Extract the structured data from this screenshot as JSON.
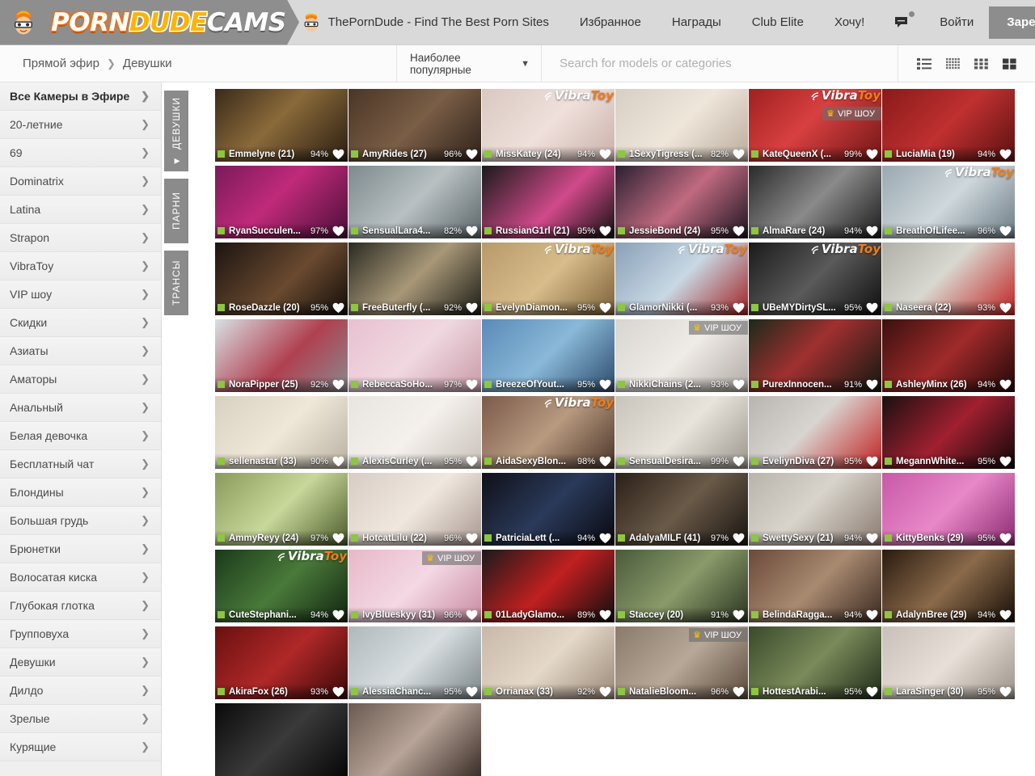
{
  "header": {
    "logo": {
      "part1": "PORN",
      "part2": "DUDE",
      "part3": "CAMS",
      "mascot_icon": "dude-mascot-icon"
    },
    "nav": [
      {
        "label": "ThePornDude - Find The Best Porn Sites",
        "name": "nav-theporndude"
      },
      {
        "label": "Избранное",
        "name": "nav-favorites"
      },
      {
        "label": "Награды",
        "name": "nav-awards"
      },
      {
        "label": "Club Elite",
        "name": "nav-club-elite"
      },
      {
        "label": "Хочу!",
        "name": "nav-want"
      }
    ],
    "chat_icon": "chat-bubble-icon",
    "login_label": "Войти",
    "register_label": "Зарегистрироват"
  },
  "subbar": {
    "breadcrumb": {
      "root": "Прямой эфир",
      "separator": "❯",
      "current": "Девушки"
    },
    "sort": {
      "value": "Наиболее популярные",
      "caret": "▼"
    },
    "search": {
      "placeholder": "Search for models or categories",
      "value": ""
    },
    "view_modes": [
      {
        "name": "view-mode-list",
        "icon": "list-view-icon",
        "active": false
      },
      {
        "name": "view-mode-tiny",
        "icon": "tiny-grid-icon",
        "active": false
      },
      {
        "name": "view-mode-small",
        "icon": "small-grid-icon",
        "active": false
      },
      {
        "name": "view-mode-large",
        "icon": "large-grid-icon",
        "active": true
      }
    ]
  },
  "sidebar": {
    "items": [
      {
        "label": "Все Камеры в Эфире",
        "active": true
      },
      {
        "label": "20-летние",
        "active": false
      },
      {
        "label": "69",
        "active": false
      },
      {
        "label": "Dominatrix",
        "active": false
      },
      {
        "label": "Latina",
        "active": false
      },
      {
        "label": "Strapon",
        "active": false
      },
      {
        "label": "VibraToy",
        "active": false
      },
      {
        "label": "VIP шоу",
        "active": false
      },
      {
        "label": " Скидки",
        "active": false
      },
      {
        "label": "Азиаты",
        "active": false
      },
      {
        "label": "Аматоры",
        "active": false
      },
      {
        "label": "Анальный",
        "active": false
      },
      {
        "label": "Белая девочка",
        "active": false
      },
      {
        "label": "Бесплатный чат",
        "active": false
      },
      {
        "label": "Блондины",
        "active": false
      },
      {
        "label": "Большая грудь",
        "active": false
      },
      {
        "label": "Брюнетки",
        "active": false
      },
      {
        "label": "Волосатая киска",
        "active": false
      },
      {
        "label": "Глубокая глотка",
        "active": false
      },
      {
        "label": "Групповуха",
        "active": false
      },
      {
        "label": "Девушки",
        "active": false
      },
      {
        "label": "Дилдо",
        "active": false
      },
      {
        "label": "Зрелые",
        "active": false
      },
      {
        "label": "Курящие",
        "active": false
      }
    ]
  },
  "vertical_tabs": [
    {
      "label": "ДЕВУШКИ",
      "active": true,
      "arrow": "◀"
    },
    {
      "label": "ПАРНИ",
      "active": false,
      "arrow": ""
    },
    {
      "label": "ТРАНСЫ",
      "active": false,
      "arrow": ""
    }
  ],
  "badges": {
    "vibratoy": {
      "part1": "Vibra",
      "part2": "Toy"
    },
    "vip": "VIP ШОУ"
  },
  "colors": {
    "live_dot": "#8dc63f",
    "vibratoy_orange": "#f07c1b",
    "crown_gold": "#ffc400",
    "register_bg": "#8d8d8d",
    "header_bg": "#d9d9d9"
  },
  "cards": [
    {
      "name": "Emmelyne (21)",
      "pct": "94%",
      "vibra": false,
      "vip": false,
      "bg": "linear-gradient(135deg,#3a2a1a,#8a6a3a 45%,#2a1d12)"
    },
    {
      "name": "AmyRides (27)",
      "pct": "96%",
      "vibra": false,
      "vip": false,
      "bg": "linear-gradient(135deg,#4a3526,#7a5e46 50%,#2e211a)"
    },
    {
      "name": "MissKatey (24)",
      "pct": "94%",
      "vibra": true,
      "vip": false,
      "bg": "linear-gradient(135deg,#d8c8c0,#f0e0dc 50%,#c8b0a8)"
    },
    {
      "name": "1SexyTigress (...",
      "pct": "82%",
      "vibra": false,
      "vip": false,
      "bg": "linear-gradient(135deg,#d8cfc4,#efe6da 50%,#b8ab9c)"
    },
    {
      "name": "KateQueenX (...",
      "pct": "99%",
      "vibra": true,
      "vip": true,
      "bg": "linear-gradient(135deg,#a02020,#d84040 45%,#701515)"
    },
    {
      "name": "LuciaMia (19)",
      "pct": "94%",
      "vibra": false,
      "vip": false,
      "bg": "linear-gradient(135deg,#8a1a1a,#c03030 50%,#5a1010)"
    },
    {
      "name": "RyanSucculen...",
      "pct": "97%",
      "vibra": false,
      "vip": false,
      "bg": "linear-gradient(135deg,#7a1a5a,#c02a7a 45%,#4a0f38)"
    },
    {
      "name": "SensualLara4...",
      "pct": "82%",
      "vibra": false,
      "vip": false,
      "bg": "linear-gradient(135deg,#7e8a8e,#b8c0c2 50%,#5a6468)"
    },
    {
      "name": "RussianG1rl (21)",
      "pct": "95%",
      "vibra": false,
      "vip": false,
      "bg": "linear-gradient(135deg,#1a1a1a,#d04a8a 55%,#101010)"
    },
    {
      "name": "JessieBond (24)",
      "pct": "95%",
      "vibra": false,
      "vip": false,
      "bg": "linear-gradient(135deg,#2a2030,#c06a80 50%,#1a1420)"
    },
    {
      "name": "AlmaRare (24)",
      "pct": "94%",
      "vibra": false,
      "vip": false,
      "bg": "linear-gradient(135deg,#2a2a2a,#8a8a8a 50%,#1a1a1a)"
    },
    {
      "name": "BreathOfLifee...",
      "pct": "96%",
      "vibra": true,
      "vip": false,
      "bg": "linear-gradient(135deg,#9aa8b0,#cfd8dc 50%,#6a7a84)"
    },
    {
      "name": "RoseDazzle (20)",
      "pct": "95%",
      "vibra": false,
      "vip": false,
      "bg": "linear-gradient(135deg,#1c1410,#6a4a30 55%,#120c08)"
    },
    {
      "name": "FreeButerfly (...",
      "pct": "92%",
      "vibra": false,
      "vip": false,
      "bg": "linear-gradient(135deg,#2a2a22,#a89878 50%,#1a1a14)"
    },
    {
      "name": "EvelynDiamon...",
      "pct": "95%",
      "vibra": true,
      "vip": false,
      "bg": "linear-gradient(135deg,#b89a6a,#d8bc8a 50%,#7a6038)"
    },
    {
      "name": "GlamorNikki (...",
      "pct": "93%",
      "vibra": true,
      "vip": false,
      "bg": "linear-gradient(135deg,#8aa0b8,#c8d8e4 50%,#a02020)"
    },
    {
      "name": "UBeMYDirtySL...",
      "pct": "95%",
      "vibra": true,
      "vip": false,
      "bg": "linear-gradient(135deg,#1a1a1a,#5a5a5a 50%,#0e0e0e)"
    },
    {
      "name": "Naseera (22)",
      "pct": "93%",
      "vibra": false,
      "vip": false,
      "bg": "linear-gradient(135deg,#b0b0a8,#d8d8d0 45%,#c02020)"
    },
    {
      "name": "NoraPipper (25)",
      "pct": "92%",
      "vibra": false,
      "vip": false,
      "bg": "linear-gradient(135deg,#d8e0e4,#b04050 55%,#8a8a90)"
    },
    {
      "name": "RebeccaSoHo...",
      "pct": "97%",
      "vibra": false,
      "vip": false,
      "bg": "linear-gradient(135deg,#e8c0d0,#f0d8e0 50%,#c89aa8)"
    },
    {
      "name": "BreezeOfYout...",
      "pct": "95%",
      "vibra": false,
      "vip": false,
      "bg": "linear-gradient(135deg,#5a8ab8,#8ab8d8 50%,#2a4a6a)"
    },
    {
      "name": "NikkiChains (2...",
      "pct": "93%",
      "vibra": false,
      "vip": true,
      "bg": "linear-gradient(135deg,#d8d4d0,#efebe6 50%,#b0aaa4)"
    },
    {
      "name": "PurexInnocen...",
      "pct": "91%",
      "vibra": false,
      "vip": false,
      "bg": "linear-gradient(135deg,#1a2a1a,#a03030 45%,#101810)"
    },
    {
      "name": "AshleyMinx (26)",
      "pct": "94%",
      "vibra": false,
      "vip": false,
      "bg": "linear-gradient(135deg,#3a1010,#a02a2a 50%,#200808)"
    },
    {
      "name": "sellenastar (33)",
      "pct": "90%",
      "vibra": false,
      "vip": false,
      "bg": "linear-gradient(135deg,#d8d0c0,#efe8d8 50%,#b8b0a0)"
    },
    {
      "name": "AlexisCurley (...",
      "pct": "95%",
      "vibra": false,
      "vip": false,
      "bg": "linear-gradient(135deg,#e8e4e0,#f4f0ec 50%,#c8c0b8)"
    },
    {
      "name": "AidaSexyBlon...",
      "pct": "98%",
      "vibra": true,
      "vip": false,
      "bg": "linear-gradient(135deg,#7a5a4a,#b89a80 50%,#4a3428)"
    },
    {
      "name": "SensualDesira...",
      "pct": "99%",
      "vibra": false,
      "vip": false,
      "bg": "linear-gradient(135deg,#c8c4bc,#e8e4dc 50%,#9a948c)"
    },
    {
      "name": "EveliynDiva (27)",
      "pct": "95%",
      "vibra": false,
      "vip": false,
      "bg": "linear-gradient(135deg,#b8b4b0,#d8d4d0 45%,#c02020)"
    },
    {
      "name": "MegannWhite...",
      "pct": "95%",
      "vibra": false,
      "vip": false,
      "bg": "linear-gradient(135deg,#1a1010,#a02030 50%,#0e0808)"
    },
    {
      "name": "AmmyReyy (24)",
      "pct": "97%",
      "vibra": false,
      "vip": false,
      "bg": "linear-gradient(135deg,#8a9a5a,#c8d89a 50%,#4a5a2a)"
    },
    {
      "name": "HotcatLilu (22)",
      "pct": "96%",
      "vibra": false,
      "vip": false,
      "bg": "linear-gradient(135deg,#d8ccc4,#f0e8e0 50%,#a89890)"
    },
    {
      "name": "PatriciaLett (...",
      "pct": "94%",
      "vibra": false,
      "vip": false,
      "bg": "linear-gradient(135deg,#101018,#2a3a5a 50%,#08080e)"
    },
    {
      "name": "AdalyaMILF (41)",
      "pct": "97%",
      "vibra": false,
      "vip": false,
      "bg": "linear-gradient(135deg,#2a2018,#6a5a48 50%,#181410)"
    },
    {
      "name": "SwettySexy (21)",
      "pct": "94%",
      "vibra": false,
      "vip": false,
      "bg": "linear-gradient(135deg,#b8b4ac,#d8d4cc 45%,#8a7a70)"
    },
    {
      "name": "KittyBenks (29)",
      "pct": "95%",
      "vibra": false,
      "vip": false,
      "bg": "linear-gradient(135deg,#c858a8,#e888c8 50%,#8a2a70)"
    },
    {
      "name": "CuteStephani...",
      "pct": "94%",
      "vibra": true,
      "vip": false,
      "bg": "linear-gradient(135deg,#1a3a1a,#4a7a3a 50%,#102410)"
    },
    {
      "name": "IvyBlueskyy (31)",
      "pct": "96%",
      "vibra": false,
      "vip": true,
      "bg": "linear-gradient(135deg,#e8b8c8,#f4d8e4 50%,#c88aa0)"
    },
    {
      "name": "01LadyGlamo...",
      "pct": "89%",
      "vibra": false,
      "vip": false,
      "bg": "linear-gradient(135deg,#1a1a1a,#c02020 50%,#0e0e0e)"
    },
    {
      "name": "Staccey (20)",
      "pct": "91%",
      "vibra": false,
      "vip": false,
      "bg": "linear-gradient(135deg,#4a5a3a,#8a9a6a 50%,#2a3420)"
    },
    {
      "name": "BelindaRagga...",
      "pct": "94%",
      "vibra": false,
      "vip": false,
      "bg": "linear-gradient(135deg,#6a4a3a,#a88a70 50%,#3a2820)"
    },
    {
      "name": "AdalynBree (29)",
      "pct": "94%",
      "vibra": false,
      "vip": false,
      "bg": "linear-gradient(135deg,#2a1a10,#8a6a4a 50%,#180e08)"
    },
    {
      "name": "AkiraFox (26)",
      "pct": "93%",
      "vibra": false,
      "vip": false,
      "bg": "linear-gradient(135deg,#6a1010,#b02828 50%,#3a0808)"
    },
    {
      "name": "AlessiaChanc...",
      "pct": "95%",
      "vibra": false,
      "vip": false,
      "bg": "linear-gradient(135deg,#b0b8bc,#d8dee0 50%,#7a8488)"
    },
    {
      "name": "Orrianax (33)",
      "pct": "92%",
      "vibra": false,
      "vip": false,
      "bg": "linear-gradient(135deg,#c8b8a8,#e4d8c8 50%,#9a8878)"
    },
    {
      "name": "NatalieBloom...",
      "pct": "96%",
      "vibra": false,
      "vip": true,
      "bg": "linear-gradient(135deg,#8a7a6a,#b8a898 50%,#5a4a3a)"
    },
    {
      "name": "HottestArabi...",
      "pct": "95%",
      "vibra": false,
      "vip": false,
      "bg": "linear-gradient(135deg,#3a4a2a,#7a8a5a 50%,#202a18)"
    },
    {
      "name": "LaraSinger (30)",
      "pct": "95%",
      "vibra": false,
      "vip": false,
      "bg": "linear-gradient(135deg,#c8c0b8,#e8e0d8 50%,#9a9088)"
    },
    {
      "name": "",
      "pct": "",
      "vibra": false,
      "vip": false,
      "bg": "linear-gradient(135deg,#0a0a0a,#3a3a3a 50%,#060606)"
    },
    {
      "name": "",
      "pct": "",
      "vibra": false,
      "vip": false,
      "bg": "linear-gradient(135deg,#6a5a50,#b8a498 50%,#3a2e28)"
    }
  ]
}
